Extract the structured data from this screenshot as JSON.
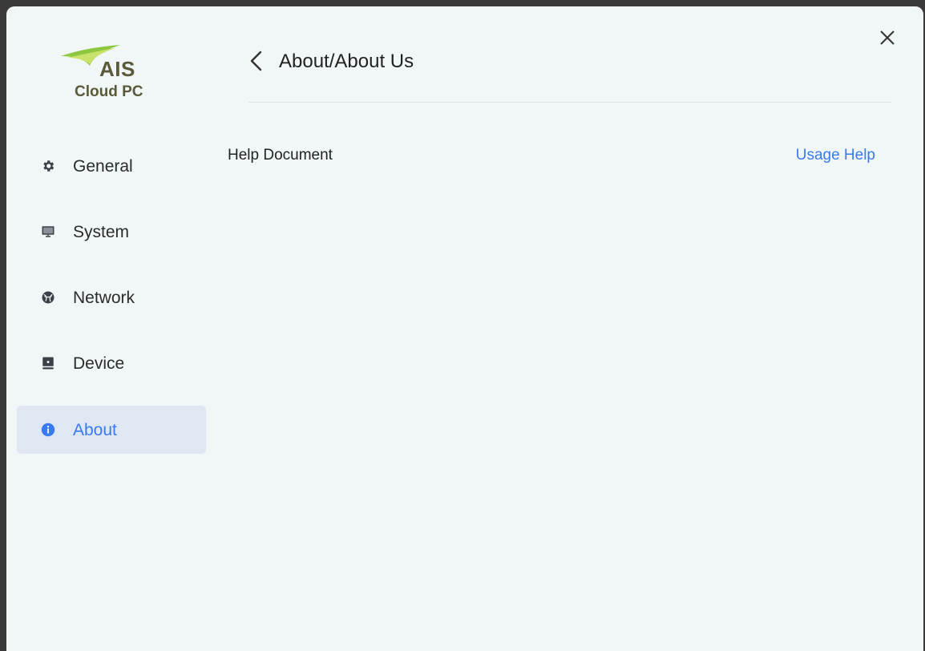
{
  "logo": {
    "brand": "AIS",
    "product": "Cloud PC"
  },
  "sidebar": {
    "items": [
      {
        "label": "General",
        "icon": "gear-icon"
      },
      {
        "label": "System",
        "icon": "monitor-icon"
      },
      {
        "label": "Network",
        "icon": "globe-icon"
      },
      {
        "label": "Device",
        "icon": "device-icon"
      },
      {
        "label": "About",
        "icon": "info-icon",
        "active": true
      }
    ]
  },
  "header": {
    "title": "About/About Us"
  },
  "content": {
    "help_label": "Help Document",
    "help_link": "Usage Help"
  },
  "colors": {
    "accent": "#3a7af0",
    "background": "#f1f6f7",
    "active_item_bg": "#dfe7f3",
    "logo_green": "#8dc63f",
    "logo_text": "#5a5a3a"
  }
}
